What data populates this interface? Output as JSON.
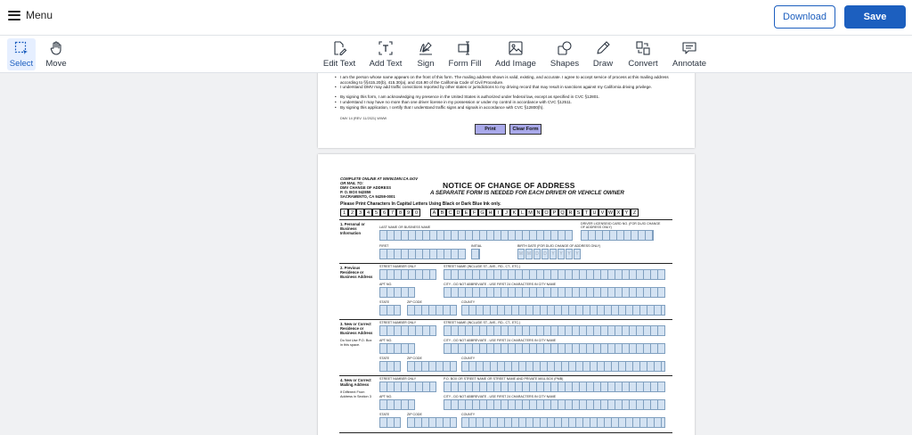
{
  "header": {
    "menu_label": "Menu",
    "download_label": "Download",
    "save_label": "Save"
  },
  "toolbar": {
    "select": "Select",
    "move": "Move",
    "edit_text": "Edit Text",
    "add_text": "Add Text",
    "sign": "Sign",
    "form_fill": "Form Fill",
    "add_image": "Add Image",
    "shapes": "Shapes",
    "draw": "Draw",
    "convert": "Convert",
    "annotate": "Annotate"
  },
  "page1": {
    "bullets": [
      "I am the person whose name appears on the front of this form. The mailing address shown is valid, existing, and accurate. I agree to accept service of process at this mailing address according to §§415.20(b), 415.30(a), and 416.90 of the California Code of Civil Procedure.",
      "I understand DMV may add traffic convictions reported by other states or jurisdictions to my driving record that may result in sanctions against my California driving privilege.",
      "By signing this form, I am acknowledging my presence in the United States is authorized under federal law, except as specified in CVC §12801.",
      "I understand I may have no more than one driver license in my possession or under my control in accordance with CVC §12511.",
      "By signing this application, I certify that I understand traffic signs and signals in accordance with CVC §12800(h)."
    ],
    "form_ref": "DMV 14 (REV. 11/2021) WWW",
    "print_button": "Print",
    "clear_button": "Clear Form"
  },
  "page2": {
    "online_line": "COMPLETE ONLINE AT WWW.DMV.CA.GOV",
    "mail_to": "OR MAIL TO:",
    "addr1": "DMV CHANGE OF ADDRESS",
    "addr2": "P. O. BOX 942859",
    "addr3": "SACRAMENTO, CA 94259-0001",
    "title": "NOTICE OF CHANGE OF ADDRESS",
    "subtitle": "A SEPARATE FORM IS NEEDED FOR EACH DRIVER OR VEHICLE OWNER",
    "instructions": "Please Print Characters In Capital Letters Using Black or Dark Blue Ink only.",
    "digits": [
      "1",
      "2",
      "3",
      "4",
      "5",
      "6",
      "7",
      "8",
      "9",
      "0"
    ],
    "letters": [
      "A",
      "B",
      "C",
      "D",
      "E",
      "F",
      "G",
      "H",
      "I",
      "J",
      "K",
      "L",
      "M",
      "N",
      "O",
      "P",
      "Q",
      "R",
      "S",
      "T",
      "U",
      "V",
      "W",
      "X",
      "Y",
      "Z"
    ],
    "sec1": "1.  Personal or Business Information",
    "sec2": "2.  Previous Residence or Business Address",
    "sec3": "3.  New or Correct Residence or Business Address",
    "sec3_note": "Do Not Use P.O. Box in this space.",
    "sec4": "4.  New or Correct Mailing Address",
    "sec4_note": "If Different From Address in Section 3",
    "lbl_last_name": "LAST NAME OR BUSINESS NAME",
    "lbl_dl": "DRIVER LICENSE/ID CARD NO. (FOR DL/ID CHANGE OF ADDRESS ONLY)",
    "lbl_first": "FIRST",
    "lbl_initial": "INITIAL",
    "lbl_birth": "BIRTH DATE (FOR DL/ID CHANGE OF ADDRESS ONLY)",
    "dob_chars": [
      "M",
      "M",
      "D",
      "D",
      "Y",
      "Y",
      "Y",
      "Y"
    ],
    "lbl_street_num": "STREET NUMBER ONLY",
    "lbl_street_name": "STREET NAME (INCLUDE ST., AVE., RD., CT., ETC.)",
    "lbl_apt": "APT NO.",
    "lbl_city": "CITY - DO NOT ABBREVIATE - USE FIRST 24 CHARACTERS IN CITY NAME",
    "lbl_state": "STATE",
    "lbl_zip": "ZIP CODE",
    "lbl_county": "COUNTY",
    "lbl_po_box": "P.O. BOX OR STREET NAME OR STREET NAME AND PRIVATE MAIL BOX (PMB)"
  }
}
